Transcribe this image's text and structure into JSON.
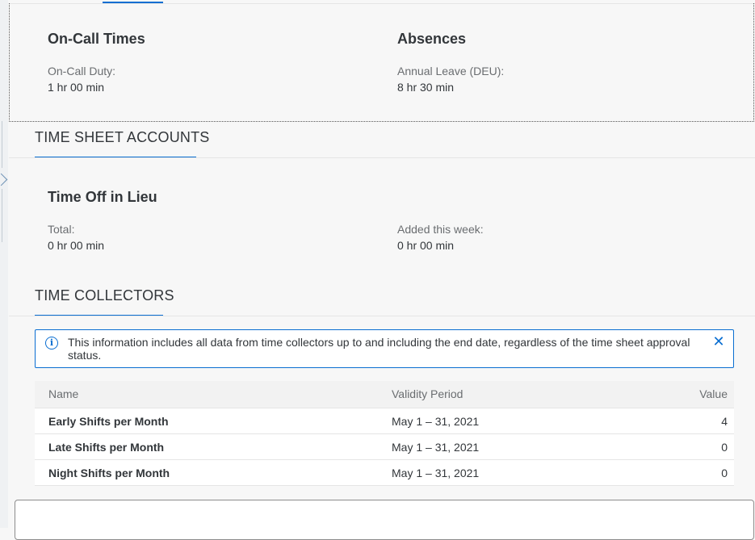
{
  "on_call": {
    "title": "On-Call Times",
    "duty_label": "On-Call Duty:",
    "duty_value": "1 hr 00 min"
  },
  "absences": {
    "title": "Absences",
    "leave_label": "Annual Leave (DEU):",
    "leave_value": "8 hr 30 min"
  },
  "time_sheet_accounts": {
    "header": "TIME SHEET ACCOUNTS",
    "group_title": "Time Off in Lieu",
    "total_label": "Total:",
    "total_value": "0 hr 00 min",
    "added_label": "Added this week:",
    "added_value": "0 hr 00 min"
  },
  "time_collectors": {
    "header": "TIME COLLECTORS",
    "info_message": "This information includes all data from time collectors up to and including the end date, regardless of the time sheet approval status.",
    "info_icon": "info-icon",
    "close_icon": "close-icon",
    "columns": {
      "name": "Name",
      "validity": "Validity Period",
      "value": "Value"
    },
    "rows": [
      {
        "name": "Early Shifts per Month",
        "validity": "May 1 – 31, 2021",
        "value": "4"
      },
      {
        "name": "Late Shifts per Month",
        "validity": "May 1 – 31, 2021",
        "value": "0"
      },
      {
        "name": "Night Shifts per Month",
        "validity": "May 1 – 31, 2021",
        "value": "0"
      }
    ]
  },
  "colors": {
    "accent": "#0a6ed1",
    "background": "#f7f7f7",
    "text": "#32363a",
    "label": "#6a6d70"
  }
}
